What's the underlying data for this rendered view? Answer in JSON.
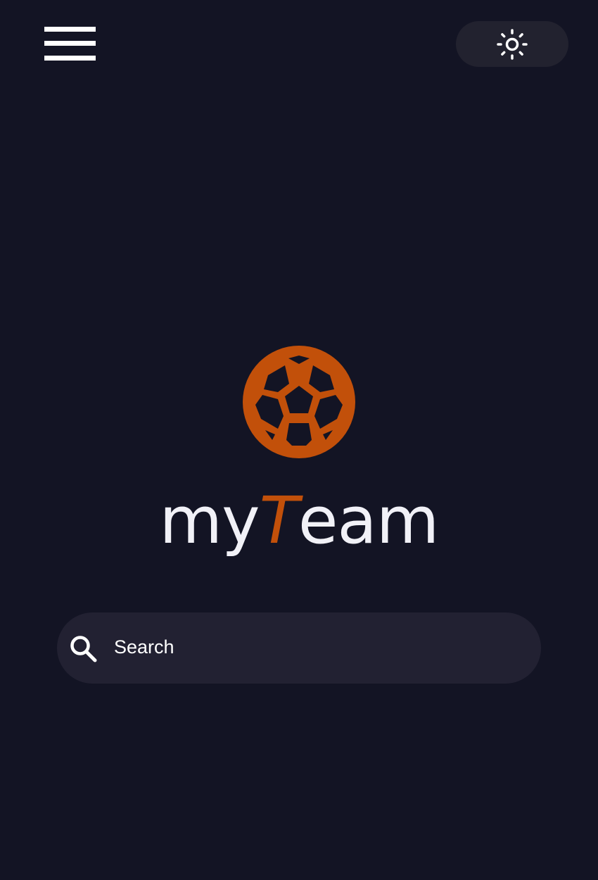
{
  "header": {
    "menu_icon": "hamburger-menu-icon",
    "theme_toggle_icon": "sun-icon"
  },
  "brand": {
    "logo_icon": "soccer-ball-icon",
    "name_prefix": "my",
    "name_accent": "T",
    "name_suffix": "eam"
  },
  "search": {
    "icon": "search-icon",
    "placeholder": "Search",
    "value": ""
  },
  "colors": {
    "background": "#131424",
    "accent": "#c2500a",
    "surface": "#22222f",
    "text": "#ffffff"
  }
}
